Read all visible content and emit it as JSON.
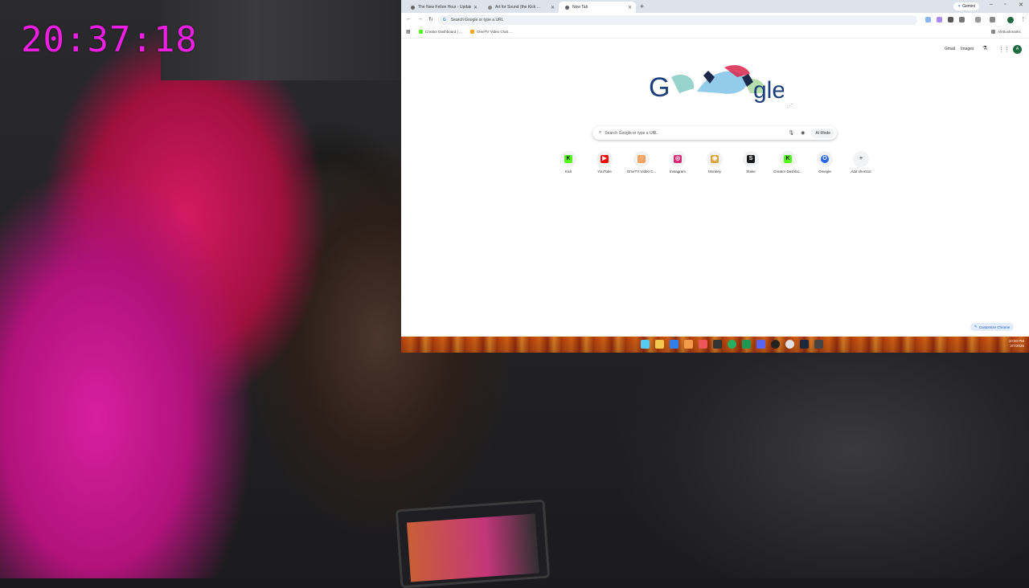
{
  "overlay": {
    "timer": "20:37:18"
  },
  "browser": {
    "tabs": [
      {
        "title": "The New Felton Hour - Update",
        "active": false
      },
      {
        "title": "Art for Sound (the Kick ...",
        "active": false
      },
      {
        "title": "New Tab",
        "active": true
      }
    ],
    "new_tab_symbol": "+",
    "gemini_label": "Gemini",
    "omnibox_placeholder": "Search Google or type a URL",
    "bookmarks": [
      {
        "label": "Creator Dashboard | ...",
        "color": "#53fc18"
      },
      {
        "label": "OmeTV Video Chat ...",
        "color": "#f6a623"
      }
    ],
    "all_bookmarks": "All Bookmarks"
  },
  "newtab": {
    "top_links": [
      "Gmail",
      "Images"
    ],
    "account_initial": "A",
    "search_placeholder": "Search Google or type a URL",
    "ai_mode_label": "AI Mode",
    "shortcuts": [
      {
        "label": "Kick",
        "icon_color": "#53fc18",
        "glyph": "K"
      },
      {
        "label": "YouTube",
        "icon_color": "#ff0000",
        "glyph": "▶"
      },
      {
        "label": "OmeTV Video C...",
        "icon_color": "#f4a261",
        "glyph": "◌"
      },
      {
        "label": "Instagram",
        "icon_color": "#d62976",
        "glyph": "◎"
      },
      {
        "label": "Monkey",
        "icon_color": "#d9a441",
        "glyph": "◉"
      },
      {
        "label": "Stake",
        "icon_color": "#1a1a1a",
        "glyph": "S"
      },
      {
        "label": "Creator Dashbo...",
        "icon_color": "#53fc18",
        "glyph": "K"
      },
      {
        "label": "Omegle",
        "icon_color": "#2563eb",
        "glyph": "O"
      },
      {
        "label": "Add shortcut",
        "icon_color": "#9aa0a6",
        "glyph": "+"
      }
    ],
    "customize_label": "Customize Chrome"
  },
  "taskbar": {
    "time": "10:50 PM",
    "date": "2/7/2026",
    "apps": [
      {
        "name": "file-explorer-icon",
        "color": "#f2c94c"
      },
      {
        "name": "edge-icon",
        "color": "#2f80ed"
      },
      {
        "name": "store-icon",
        "color": "#56ccf2"
      },
      {
        "name": "folder-icon",
        "color": "#f2994a"
      },
      {
        "name": "brave-icon",
        "color": "#eb5757"
      },
      {
        "name": "terminal-icon",
        "color": "#333333"
      },
      {
        "name": "spotify-icon",
        "color": "#27ae60"
      },
      {
        "name": "xbox-icon",
        "color": "#219653"
      },
      {
        "name": "discord-icon",
        "color": "#5865f2"
      },
      {
        "name": "obs-icon",
        "color": "#222222"
      },
      {
        "name": "chrome-icon",
        "color": "#e0e0e0"
      },
      {
        "name": "steam-icon",
        "color": "#1b2838"
      },
      {
        "name": "calculator-icon",
        "color": "#444444"
      }
    ]
  }
}
